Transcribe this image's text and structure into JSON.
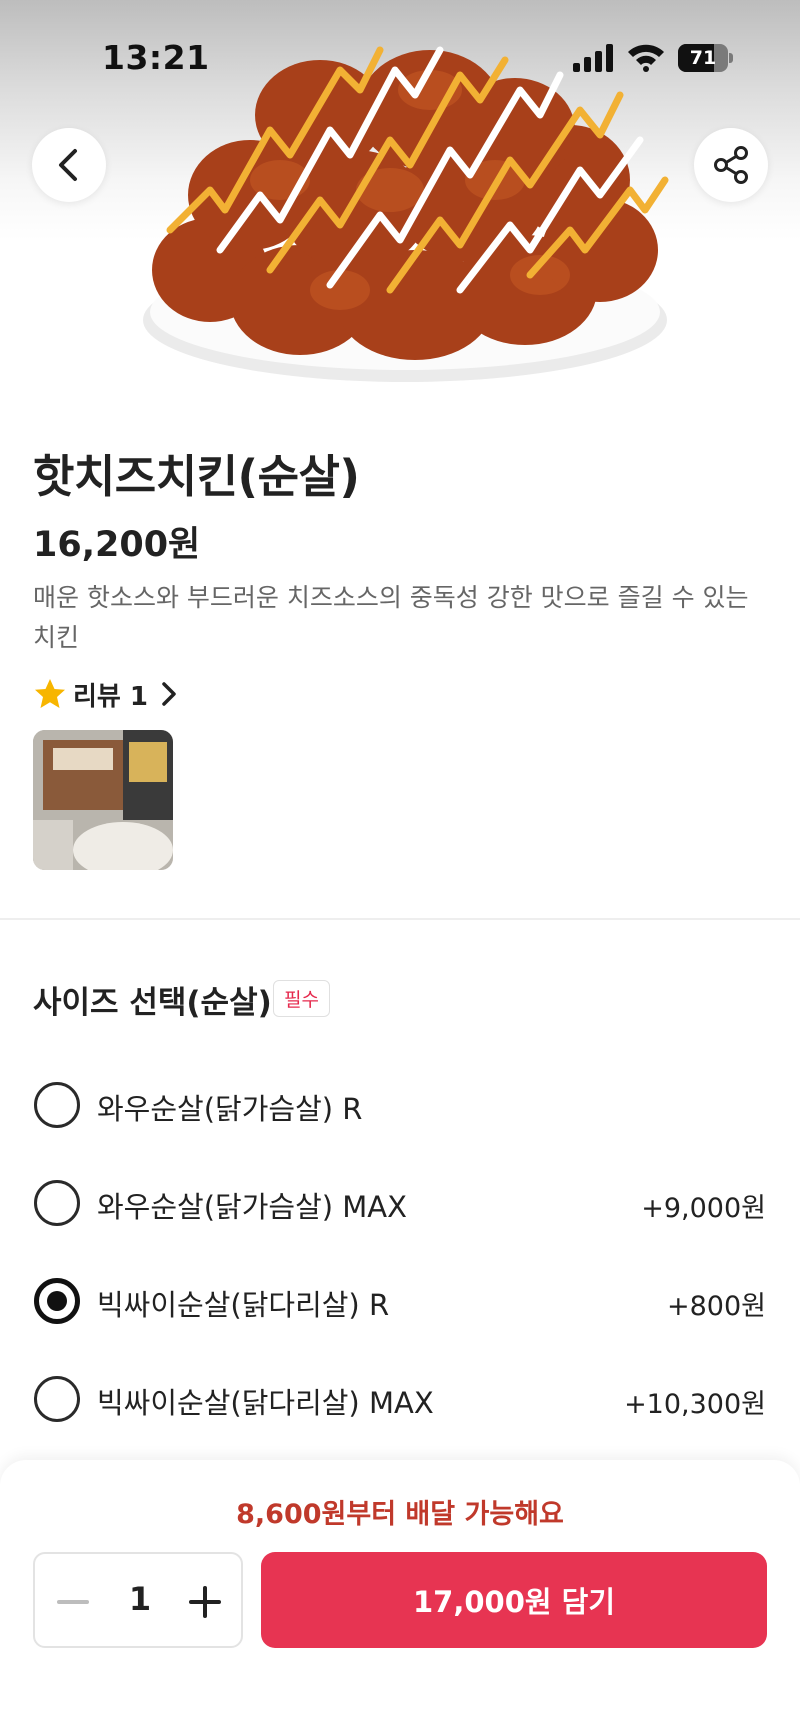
{
  "status_bar": {
    "time": "13:21",
    "battery_level": "71",
    "battery_fraction": 0.71,
    "icons": [
      "signal-icon",
      "wifi-icon",
      "battery-icon"
    ]
  },
  "header": {
    "back_icon": "chevron-left-icon",
    "share_icon": "share-icon"
  },
  "product": {
    "name": "핫치즈치킨(순살)",
    "price": "16,200원",
    "description": "매운 핫소스와 부드러운 치즈소스의 중독성 강한 맛으로 즐길 수 있는 치킨",
    "review_label": "리뷰 1",
    "review_icon": "star-icon"
  },
  "options": {
    "title": "사이즈 선택(순살)",
    "badge": "필수",
    "items": [
      {
        "label": "와우순살(닭가슴살) R",
        "price": "",
        "selected": false
      },
      {
        "label": "와우순살(닭가슴살) MAX",
        "price": "+9,000원",
        "selected": false
      },
      {
        "label": "빅싸이순살(닭다리살) R",
        "price": "+800원",
        "selected": true
      },
      {
        "label": "빅싸이순살(닭다리살) MAX",
        "price": "+10,300원",
        "selected": false
      }
    ]
  },
  "footer": {
    "min_order": "8,600원부터 배달 가능해요",
    "quantity": "1",
    "add_button": "17,000원 담기"
  },
  "colors": {
    "accent": "#e73452",
    "notice": "#c0392b",
    "badge_text": "#e5294d"
  }
}
